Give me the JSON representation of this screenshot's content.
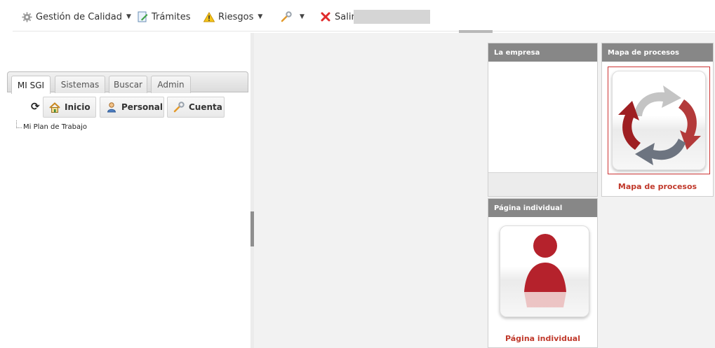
{
  "menubar": {
    "items": [
      {
        "label": "Gestión de Calidad",
        "icon": "gear-icon",
        "has_dropdown": true
      },
      {
        "label": "Trámites",
        "icon": "document-edit-icon",
        "has_dropdown": false
      },
      {
        "label": "Riesgos",
        "icon": "warning-icon",
        "has_dropdown": true
      },
      {
        "label": "",
        "icon": "wrench-icon",
        "has_dropdown": true
      },
      {
        "label": "Salir",
        "icon": "close-icon",
        "has_dropdown": false
      }
    ]
  },
  "left": {
    "tabs": [
      {
        "label": "MI SGI",
        "active": true
      },
      {
        "label": "Sistemas",
        "active": false
      },
      {
        "label": "Buscar",
        "active": false
      },
      {
        "label": "Admin",
        "active": false
      }
    ],
    "toolbar": {
      "refresh_icon": "refresh-icon",
      "inicio_label": "Inicio",
      "personal_label": "Personal",
      "cuenta_label": "Cuenta"
    },
    "tree": {
      "node_label": "Mi Plan de Trabajo"
    }
  },
  "portlets": {
    "empresa": {
      "title": "La empresa"
    },
    "mapa": {
      "title": "Mapa de procesos",
      "link": "Mapa de procesos"
    },
    "individual": {
      "title": "Página individual",
      "link": "Página individual"
    }
  },
  "colors": {
    "accent": "#c0392b",
    "portlet_header": "#878787",
    "content_bg": "#f2f2f2"
  }
}
